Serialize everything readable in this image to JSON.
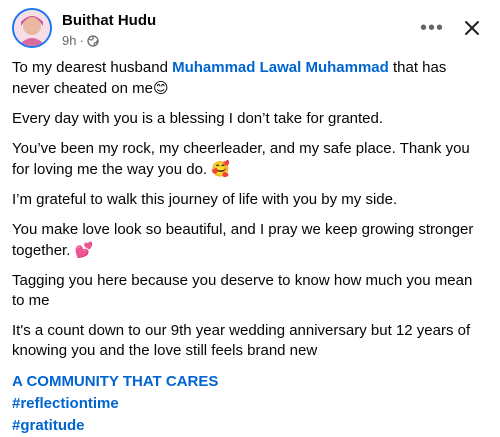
{
  "post": {
    "author": "Buithat Hudu",
    "time": "9h",
    "dot": "·",
    "header_actions": {
      "more": "•••",
      "close": "✕"
    },
    "p1_prefix": "To my dearest husband ",
    "p1_mention": "Muhammad Lawal Muhammad",
    "p1_suffix": " that has never cheated on me",
    "p1_emoji": "😊",
    "p2": "Every day with you is a blessing I don’t take for granted.",
    "p3": "You’ve been my rock, my cheerleader, and my safe place. Thank you for loving me the way you do.",
    "p3_emoji": "🥰",
    "p4": "I’m grateful to walk this journey of life with you by my side.",
    "p5": "You make love look so beautiful, and I pray we keep growing stronger together.",
    "p5_emoji": "💕",
    "p6": "Tagging you here because you deserve to know how much you mean to me",
    "p7": "It's a count down to our 9th year wedding anniversary but 12 years of knowing you and the love still feels brand new",
    "hashtags": [
      "A COMMUNITY THAT CARES",
      "#reflectiontime",
      "#gratitude"
    ]
  },
  "icons": {
    "avatar": "avatar",
    "privacy": "globe-icon",
    "more": "more-icon",
    "close": "close-icon"
  },
  "colors": {
    "link": "#0064d1",
    "secondary_text": "#65676b",
    "text": "#050505"
  }
}
